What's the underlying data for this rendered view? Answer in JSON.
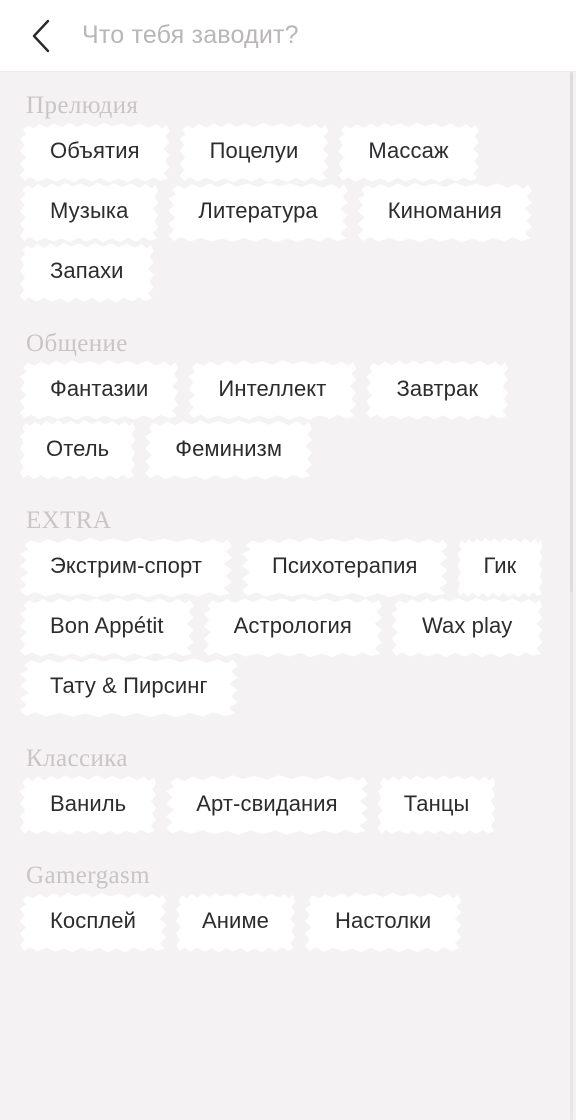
{
  "header": {
    "back_icon": "chevron-left-icon",
    "title": "Что тебя заводит?"
  },
  "colors": {
    "background": "#f4f2f3",
    "header_background": "#ffffff",
    "chip_background": "#ffffff",
    "chip_text": "#2c2b2e",
    "section_title": "#c9c5c7",
    "header_title": "#b9b5b8"
  },
  "sections": [
    {
      "title": "Прелюдия",
      "chips": [
        "Объятия",
        "Поцелуи",
        "Массаж",
        "Музыка",
        "Литература",
        "Киномания",
        "Запахи"
      ]
    },
    {
      "title": "Общение",
      "chips": [
        "Фантазии",
        "Интеллект",
        "Завтрак",
        "Отель",
        "Феминизм"
      ]
    },
    {
      "title": "EXTRA",
      "chips": [
        "Экстрим-спорт",
        "Психотерапия",
        "Гик",
        "Bon Appétit",
        "Астрология",
        "Wax play",
        "Тату & Пирсинг"
      ]
    },
    {
      "title": "Классика",
      "chips": [
        "Ваниль",
        "Арт-свидания",
        "Танцы"
      ]
    },
    {
      "title": "Gamergasm",
      "chips": [
        "Косплей",
        "Аниме",
        "Настолки"
      ]
    }
  ]
}
